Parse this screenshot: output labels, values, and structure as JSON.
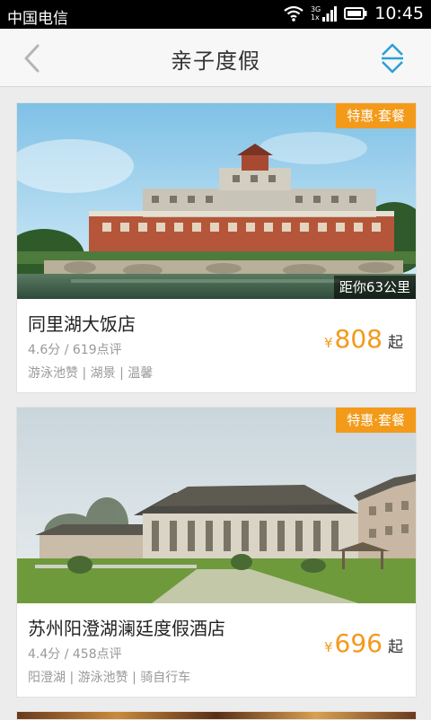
{
  "status_bar": {
    "carrier": "中国电信",
    "network_top": "3G",
    "network_bottom": "1x",
    "time": "10:45"
  },
  "nav": {
    "title": "亲子度假",
    "accent": "#2b9fd8"
  },
  "hotels": [
    {
      "badge": "特惠·套餐",
      "distance": "距你63公里",
      "name": "同里湖大饭店",
      "rating": "4.6分 / 619点评",
      "tags": "游泳池赞 | 湖景 | 温馨",
      "currency": "¥",
      "price": "808",
      "price_suffix": "起"
    },
    {
      "badge": "特惠·套餐",
      "name": "苏州阳澄湖澜廷度假酒店",
      "rating": "4.4分 / 458点评",
      "tags": "阳澄湖 | 游泳池赞 | 骑自行车",
      "currency": "¥",
      "price": "696",
      "price_suffix": "起"
    }
  ],
  "colors": {
    "badge": "#f39a1a",
    "price": "#f39a1a"
  }
}
